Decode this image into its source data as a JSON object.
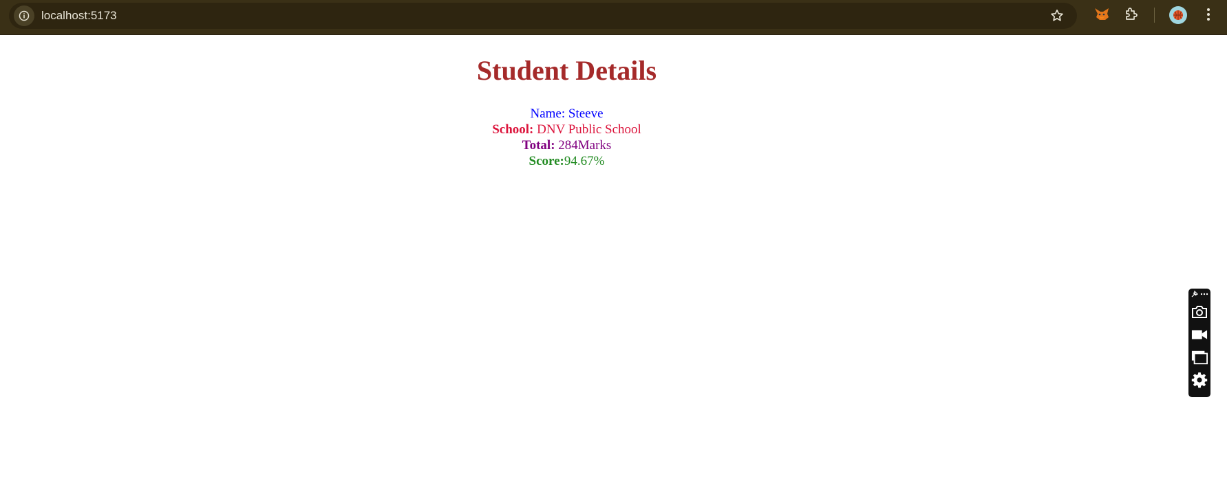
{
  "browser": {
    "url": "localhost:5173",
    "icons": [
      "info-icon",
      "bookmark-star-icon",
      "metamask-fox-icon",
      "extensions-puzzle-icon",
      "profile-avatar",
      "more-menu-icon"
    ]
  },
  "page": {
    "title": "Student Details",
    "name_label": "Name: ",
    "name_value": "Steeve",
    "school_label": "School:",
    "school_value": " DNV Public School",
    "total_label": "Total:",
    "total_value": " 284Marks",
    "score_label": "Score:",
    "score_value": "94.67%"
  },
  "colors": {
    "title": "#a52a2a",
    "name": "#0000ff",
    "school": "#dc143c",
    "total": "#800080",
    "score": "#228b22",
    "browser_bar": "#3a3016"
  },
  "side_toolbar": {
    "icons": [
      "pin-icon",
      "more-icon",
      "camera-icon",
      "video-icon",
      "windows-icon",
      "settings-gear-icon"
    ]
  }
}
